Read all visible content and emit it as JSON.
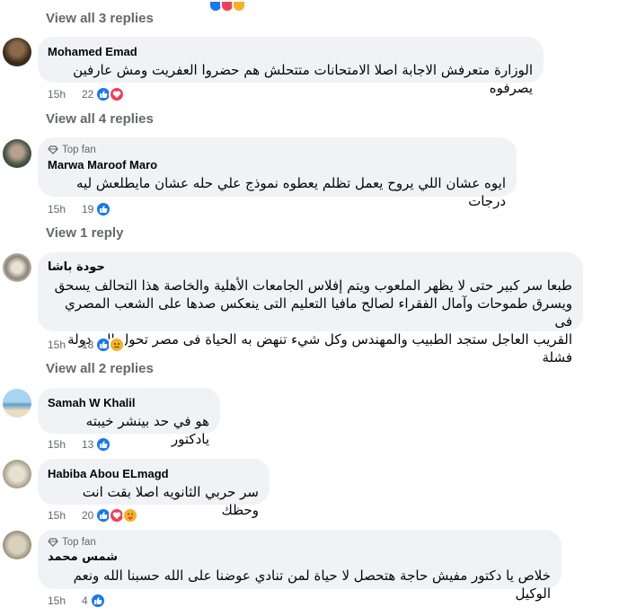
{
  "view_replies": [
    "View all 3 replies",
    "View all 4 replies",
    "View 1 reply",
    "View all 2 replies"
  ],
  "top_fan_label": "Top fan",
  "comments": [
    {
      "author": "Mohamed Emad",
      "text": "الوزارة متعرفش الاجابة اصلا الامتحانات متتحلش هم حضروا العفريت ومش عارفين يصرفوه",
      "time": "15h",
      "count": "22",
      "reactions": [
        "like-icon",
        "love-icon"
      ]
    },
    {
      "author": "Marwa Maroof Maro",
      "text": "ايوه عشان اللي يروح يعمل تظلم يعطوه نموذج علي حله عشان مايطلعش ليه درجات",
      "time": "15h",
      "count": "19",
      "reactions": [
        "like-icon"
      ]
    },
    {
      "author": "حودة باشا",
      "text_lines": [
        "طبعا سر كبير حتى لا يظهر الملعوب ويتم إفلاس الجامعات الأهلية والخاصة هذا التحالف يسحق",
        "ويسرق طموحات وآمال الفقراء لصالح مافيا التعليم التى ينعكس صدها على الشعب المصري فى",
        "القريب العاجل ستجد الطبيب والمهندس وكل شيء تنهض به الحياة فى مصر تحول إلى دولة فشلة"
      ],
      "time": "15h",
      "count": "18",
      "reactions": [
        "like-icon",
        "sad-icon"
      ]
    },
    {
      "author": "Samah W Khalil",
      "text": "هو في حد بينشر خيبته يادكتور",
      "time": "15h",
      "count": "13",
      "reactions": [
        "like-icon"
      ]
    },
    {
      "author": "Habiba Abou ELmagd",
      "text": "سر حربي الثانويه اصلا بقت انت وحظك",
      "time": "15h",
      "count": "20",
      "reactions": [
        "like-icon",
        "love-icon",
        "care-icon"
      ]
    },
    {
      "author": "شمس محمد",
      "text": "خلاص يا دكتور مفيش حاجة هتحصل لا حياة لمن تنادي عوضنا على الله حسبنا الله ونعم الوكيل",
      "time": "15h",
      "count": "4",
      "reactions": [
        "like-icon"
      ]
    }
  ],
  "colors": {
    "like": "#1877f2",
    "love": "#f33e58",
    "bubble": "#f0f2f5",
    "secondary_text": "#65676b"
  }
}
